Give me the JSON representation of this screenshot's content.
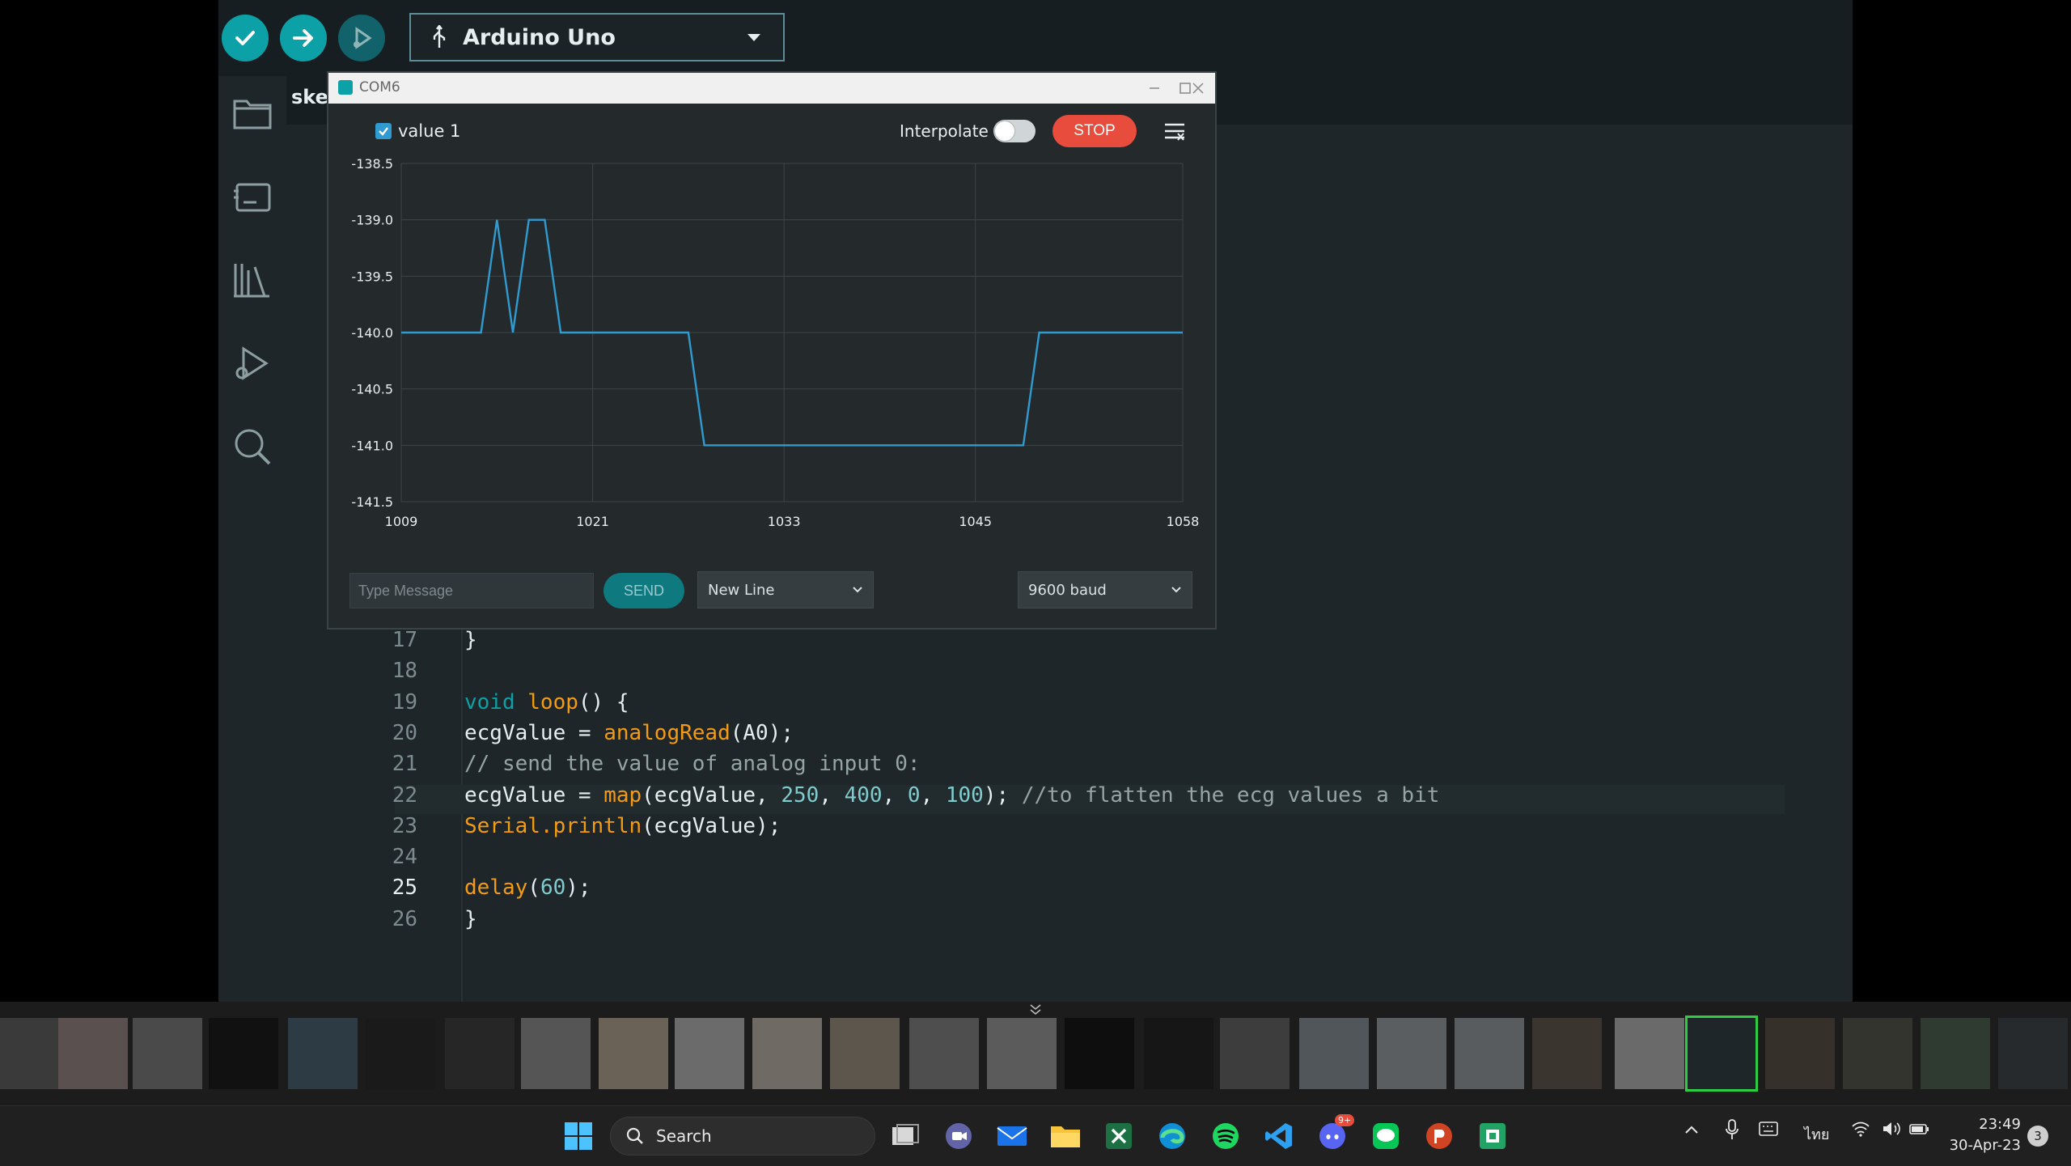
{
  "toolbar": {
    "verify": "verify-icon",
    "upload": "upload-icon",
    "debug": "debug-icon",
    "board": "Arduino Uno",
    "board_icon": "usb-icon"
  },
  "sidebar": {
    "items": [
      "folder-icon",
      "boards-icon",
      "library-icon",
      "debug-icon",
      "search-icon"
    ]
  },
  "editor": {
    "tab": "ske",
    "lines": [
      {
        "n": "17",
        "text": "}"
      },
      {
        "n": "18",
        "text": ""
      },
      {
        "n": "19",
        "text": "void loop() {"
      },
      {
        "n": "20",
        "text": "ecgValue = analogRead(A0);"
      },
      {
        "n": "21",
        "text": "// send the value of analog input 0:"
      },
      {
        "n": "22",
        "text": "ecgValue = map(ecgValue, 250, 400, 0, 100); //to flatten the ecg values a bit"
      },
      {
        "n": "23",
        "text": "Serial.println(ecgValue);"
      },
      {
        "n": "24",
        "text": ""
      },
      {
        "n": "25",
        "text": "delay(60);"
      },
      {
        "n": "26",
        "text": "}"
      }
    ],
    "active_line": "25"
  },
  "plotter": {
    "title": "COM6",
    "series_label": "value 1",
    "series_checked": true,
    "interpolate_label": "Interpolate",
    "interpolate_on": false,
    "stop_label": "STOP",
    "message_placeholder": "Type Message",
    "send_label": "SEND",
    "line_ending": "New Line",
    "baud": "9600 baud"
  },
  "chart_data": {
    "type": "line",
    "x_ticks": [
      "1009",
      "1021",
      "1033",
      "1045",
      "1058"
    ],
    "y_ticks": [
      "-138.5",
      "-139.0",
      "-139.5",
      "-140.0",
      "-140.5",
      "-141.0",
      "-141.5"
    ],
    "xlim": [
      1009,
      1058
    ],
    "ylim": [
      -141.5,
      -138.5
    ],
    "grid": true,
    "legend": "top-left",
    "series": [
      {
        "name": "value 1",
        "color": "#2f9bd0",
        "x": [
          1009,
          1014,
          1015,
          1016,
          1017,
          1018,
          1019,
          1027,
          1028,
          1048,
          1049,
          1058
        ],
        "y": [
          -140,
          -140,
          -139,
          -140,
          -139,
          -139,
          -140,
          -140,
          -141,
          -141,
          -140,
          -140
        ]
      }
    ]
  },
  "taskbar": {
    "search_label": "Search",
    "apps": [
      "windows-start-icon",
      "file-explorer-window-icon",
      "teams-icon",
      "mail-icon",
      "folder-icon",
      "excel-icon",
      "edge-icon",
      "spotify-icon",
      "vscode-icon",
      "discord-icon",
      "line-icon",
      "powerpoint-icon",
      "app-icon"
    ],
    "discord_badge": "9+",
    "lang": "ไทย",
    "time": "23:49",
    "date": "30-Apr-23",
    "notifications": "3"
  },
  "colors": {
    "accent": "#0ca1a6",
    "stop": "#e74c3c",
    "series": "#2f9bd0",
    "ide_bg": "#171e21"
  }
}
